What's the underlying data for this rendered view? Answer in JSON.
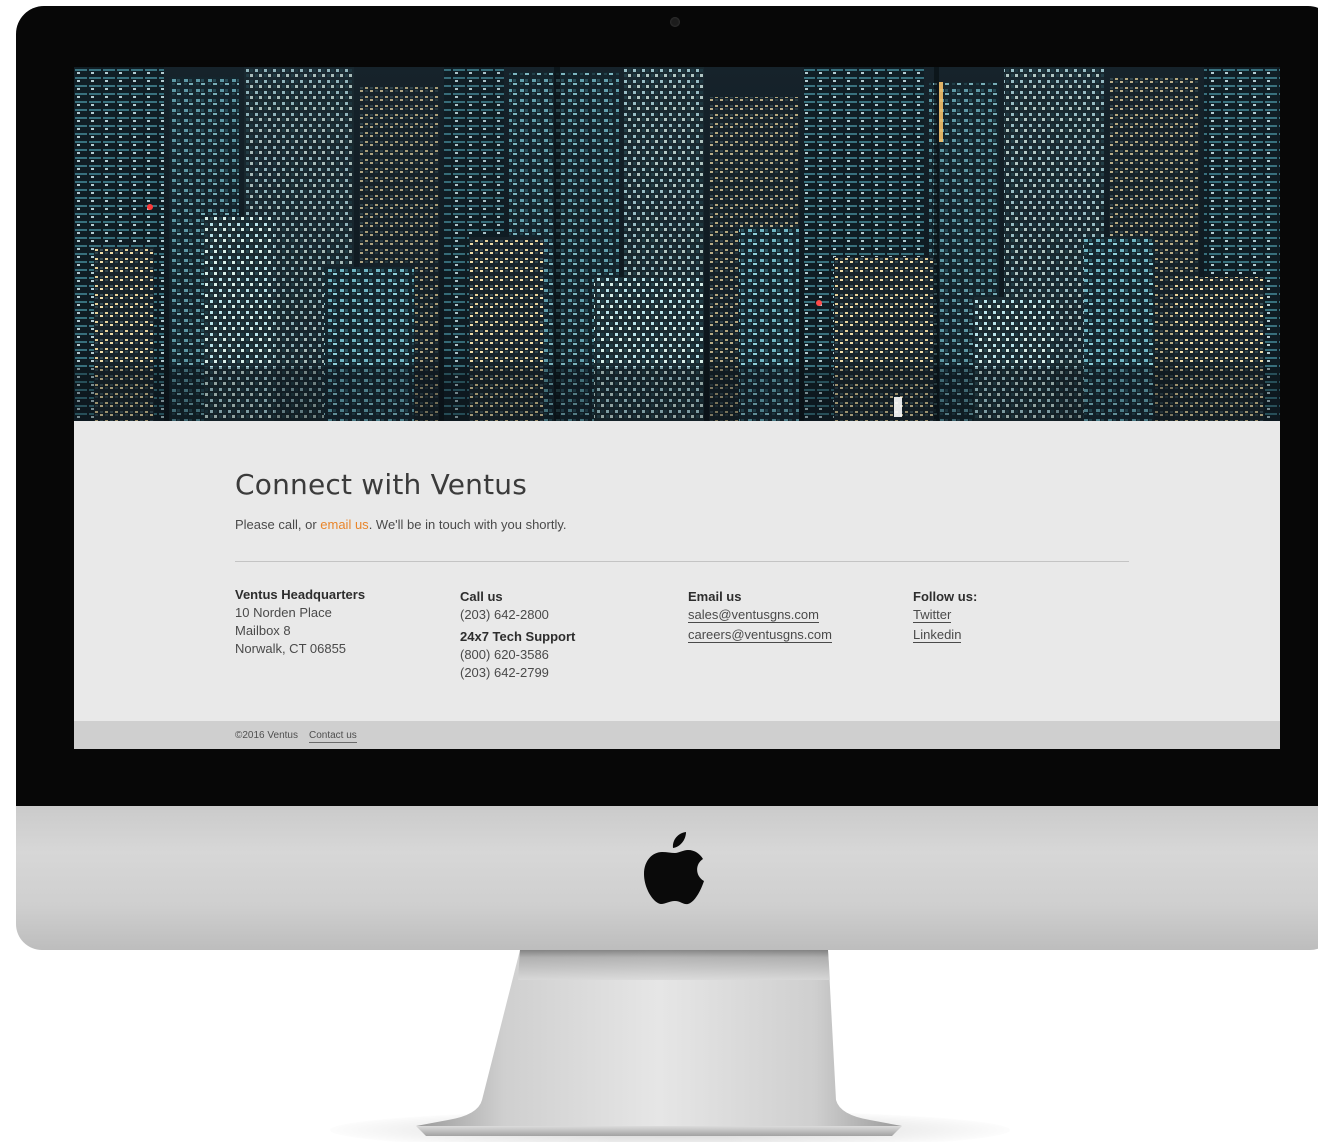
{
  "colors": {
    "accent": "#e9852a",
    "page_background": "#e9e9e9",
    "footer_background": "#cfcfcf",
    "bezel": "#070707",
    "aluminum": "#d0d0d0"
  },
  "hero": {
    "image": "night-city-skyline-image"
  },
  "contact": {
    "title": "Connect with Ventus",
    "intro_before": "Please call, or ",
    "intro_link": "email us",
    "intro_after": ". We'll be in touch with you shortly."
  },
  "columns": {
    "hq": {
      "heading": "Ventus Headquarters",
      "lines": [
        "10 Norden Place",
        "Mailbox 8",
        "Norwalk, CT 06855"
      ]
    },
    "call": {
      "heading": "Call us",
      "phone": "(203) 642-2800",
      "support_heading": "24x7 Tech Support",
      "support_phones": [
        "(800) 620-3586",
        "(203) 642-2799"
      ]
    },
    "email": {
      "heading": "Email us",
      "links": [
        "sales@ventusgns.com",
        "careers@ventusgns.com"
      ]
    },
    "follow": {
      "heading": "Follow us:",
      "links": [
        "Twitter",
        "Linkedin"
      ]
    }
  },
  "footer": {
    "copyright": "©2016 Ventus",
    "contact_link": "Contact us"
  },
  "device": {
    "logo_icon": "apple-logo-icon",
    "camera_icon": "camera-icon"
  }
}
